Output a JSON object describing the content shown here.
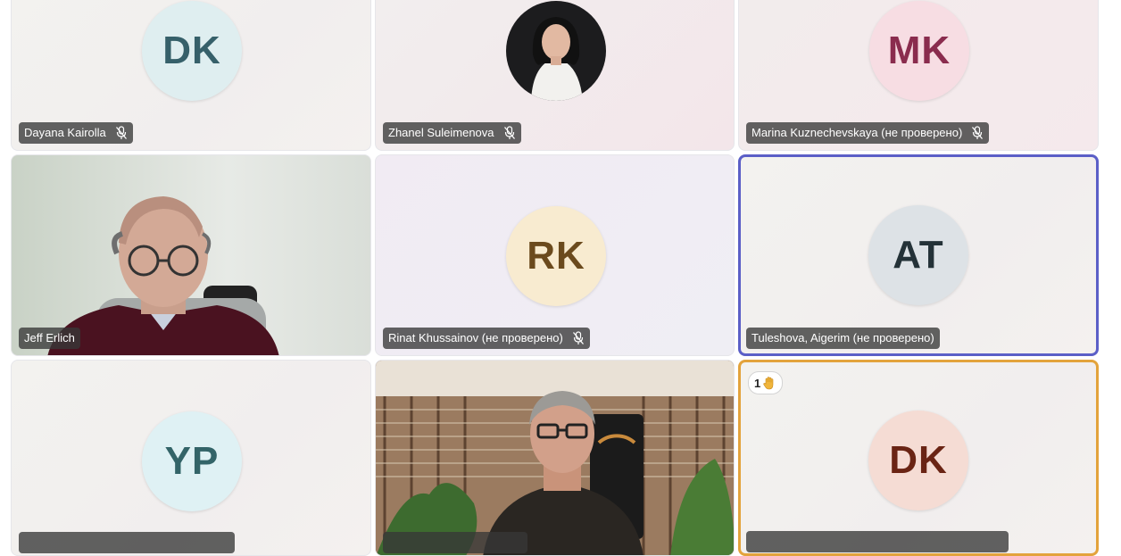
{
  "participants": [
    {
      "name": "Dayana Kairolla",
      "initials": "DK",
      "muted": true
    },
    {
      "name": "Zhanel Suleimenova",
      "initials": "",
      "muted": true
    },
    {
      "name": "Marina Kuznechevskaya (не проверено)",
      "initials": "MK",
      "muted": true
    },
    {
      "name": "Jeff Erlich",
      "initials": "",
      "muted": false
    },
    {
      "name": "Rinat Khussainov (не проверено)",
      "initials": "RK",
      "muted": true
    },
    {
      "name": "Tuleshova, Aigerim (не проверено)",
      "initials": "AT",
      "muted": false,
      "speaking": true
    },
    {
      "name": "",
      "initials": "YP",
      "muted": false
    },
    {
      "name": "",
      "initials": "",
      "muted": false
    },
    {
      "name": "",
      "initials": "DK",
      "muted": false,
      "hand_raised": true
    }
  ],
  "hand_raise": {
    "count": "1",
    "icon": "raised-hand-icon"
  },
  "colors": {
    "speaking_border": "#5b5fc7",
    "hand_border": "#e3a33c",
    "nametag_bg": "#373737"
  }
}
